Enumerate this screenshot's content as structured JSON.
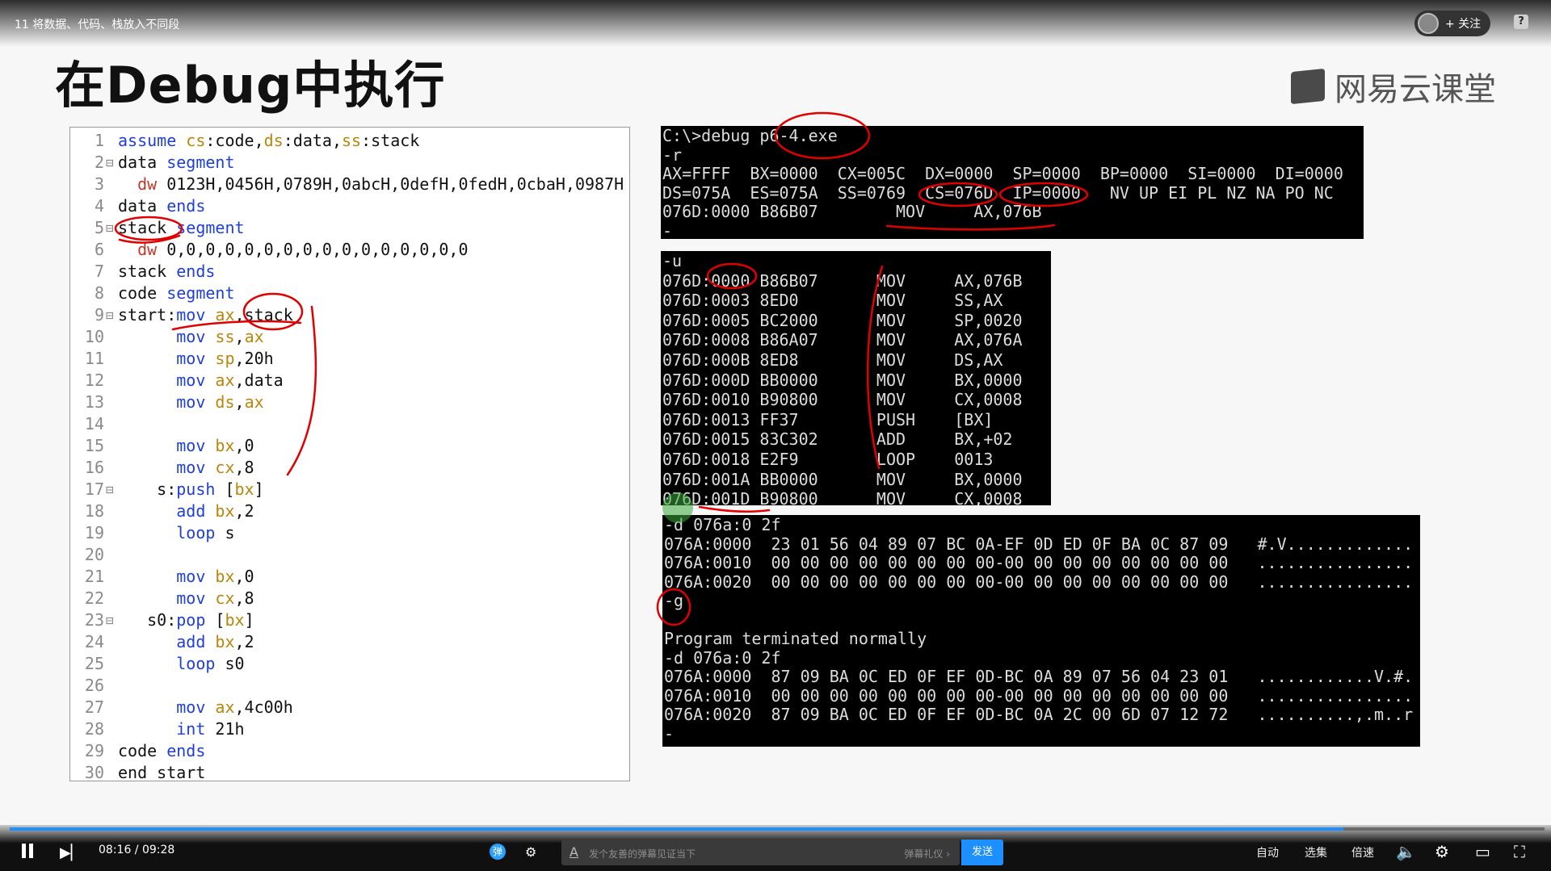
{
  "header": {
    "video_title": "11 将数据、代码、栈放入不同段",
    "follow_label": "+ 关注",
    "help_label": "?"
  },
  "slide": {
    "title": "在Debug中执行",
    "brand": "网易云课堂"
  },
  "code": {
    "lines": [
      {
        "n": "1",
        "fold": "",
        "text": "assume cs:code,ds:data,ss:stack"
      },
      {
        "n": "2",
        "fold": "⊟",
        "text": "data segment"
      },
      {
        "n": "3",
        "fold": "",
        "text": "  dw 0123H,0456H,0789H,0abcH,0defH,0fedH,0cbaH,0987H"
      },
      {
        "n": "4",
        "fold": "",
        "text": "data ends"
      },
      {
        "n": "5",
        "fold": "⊟",
        "text": "stack segment"
      },
      {
        "n": "6",
        "fold": "",
        "text": "  dw 0,0,0,0,0,0,0,0,0,0,0,0,0,0,0,0"
      },
      {
        "n": "7",
        "fold": "",
        "text": "stack ends"
      },
      {
        "n": "8",
        "fold": "",
        "text": "code segment"
      },
      {
        "n": "9",
        "fold": "⊟",
        "text": "start:mov ax,stack"
      },
      {
        "n": "10",
        "fold": "",
        "text": "      mov ss,ax"
      },
      {
        "n": "11",
        "fold": "",
        "text": "      mov sp,20h"
      },
      {
        "n": "12",
        "fold": "",
        "text": "      mov ax,data"
      },
      {
        "n": "13",
        "fold": "",
        "text": "      mov ds,ax"
      },
      {
        "n": "14",
        "fold": "",
        "text": ""
      },
      {
        "n": "15",
        "fold": "",
        "text": "      mov bx,0"
      },
      {
        "n": "16",
        "fold": "",
        "text": "      mov cx,8"
      },
      {
        "n": "17",
        "fold": "⊟",
        "text": "    s:push [bx]"
      },
      {
        "n": "18",
        "fold": "",
        "text": "      add bx,2"
      },
      {
        "n": "19",
        "fold": "",
        "text": "      loop s"
      },
      {
        "n": "20",
        "fold": "",
        "text": ""
      },
      {
        "n": "21",
        "fold": "",
        "text": "      mov bx,0"
      },
      {
        "n": "22",
        "fold": "",
        "text": "      mov cx,8"
      },
      {
        "n": "23",
        "fold": "⊟",
        "text": "   s0:pop [bx]"
      },
      {
        "n": "24",
        "fold": "",
        "text": "      add bx,2"
      },
      {
        "n": "25",
        "fold": "",
        "text": "      loop s0"
      },
      {
        "n": "26",
        "fold": "",
        "text": ""
      },
      {
        "n": "27",
        "fold": "",
        "text": "      mov ax,4c00h"
      },
      {
        "n": "28",
        "fold": "",
        "text": "      int 21h"
      },
      {
        "n": "29",
        "fold": "",
        "text": "code ends"
      },
      {
        "n": "30",
        "fold": "",
        "text": "end start"
      }
    ]
  },
  "terminal1": {
    "lines": [
      "C:\\>debug p6-4.exe",
      "-r",
      "AX=FFFF  BX=0000  CX=005C  DX=0000  SP=0000  BP=0000  SI=0000  DI=0000",
      "DS=075A  ES=075A  SS=0769  CS=076D  IP=0000   NV UP EI PL NZ NA PO NC",
      "076D:0000 B86B07        MOV     AX,076B",
      "-"
    ]
  },
  "terminal2": {
    "lines": [
      "-u",
      "076D:0000 B86B07      MOV     AX,076B",
      "076D:0003 8ED0        MOV     SS,AX",
      "076D:0005 BC2000      MOV     SP,0020",
      "076D:0008 B86A07      MOV     AX,076A",
      "076D:000B 8ED8        MOV     DS,AX",
      "076D:000D BB0000      MOV     BX,0000",
      "076D:0010 B90800      MOV     CX,0008",
      "076D:0013 FF37        PUSH    [BX]",
      "076D:0015 83C302      ADD     BX,+02",
      "076D:0018 E2F9        LOOP    0013",
      "076D:001A BB0000      MOV     BX,0000",
      "076D:001D B90800      MOV     CX,0008"
    ]
  },
  "terminal3": {
    "lines": [
      "-d 076a:0 2f",
      "076A:0000  23 01 56 04 89 07 BC 0A-EF 0D ED 0F BA 0C 87 09   #.V.............",
      "076A:0010  00 00 00 00 00 00 00 00-00 00 00 00 00 00 00 00   ................",
      "076A:0020  00 00 00 00 00 00 00 00-00 00 00 00 00 00 00 00   ................",
      "-g",
      "",
      "Program terminated normally",
      "-d 076a:0 2f",
      "076A:0000  87 09 BA 0C ED 0F EF 0D-BC 0A 89 07 56 04 23 01   ............V.#.",
      "076A:0010  00 00 00 00 00 00 00 00-00 00 00 00 00 00 00 00   ................",
      "076A:0020  87 09 BA 0C ED 0F EF 0D-BC 0A 2C 00 6D 07 12 72   ..........,.m..r",
      "-"
    ]
  },
  "player": {
    "time": "08:16 / 09:28",
    "progress": 0.869,
    "danmaku_toggle": "弹",
    "danmaku_placeholder": "发个友善的弹幕见证当下",
    "danmaku_gift": "弹幕礼仪 ›",
    "send_label": "发送",
    "auto_label": "自动",
    "episodes_label": "选集",
    "speed_label": "倍速",
    "accent": "#1e8fff"
  }
}
